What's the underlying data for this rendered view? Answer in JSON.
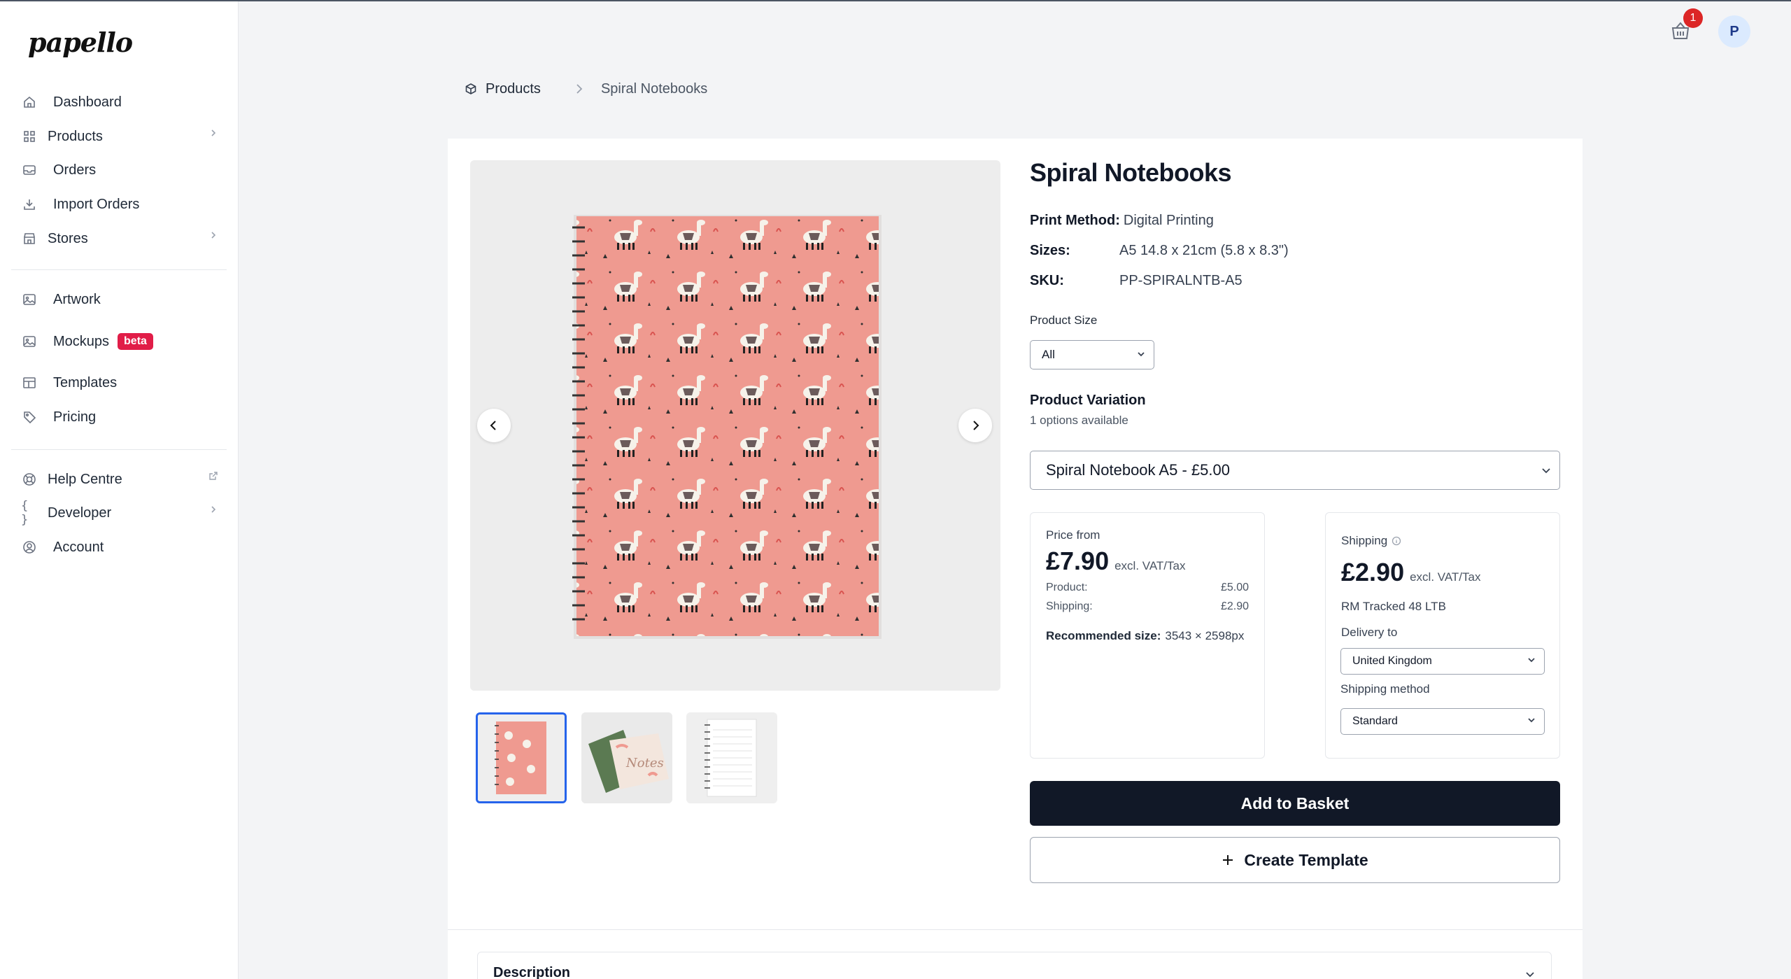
{
  "brand": {
    "logo_text": "papello"
  },
  "sidebar": {
    "items": [
      {
        "label": "Dashboard",
        "icon": "home-icon"
      },
      {
        "label": "Products",
        "icon": "grid-icon",
        "has_children": true
      },
      {
        "label": "Orders",
        "icon": "inbox-icon"
      },
      {
        "label": "Import Orders",
        "icon": "import-icon"
      },
      {
        "label": "Stores",
        "icon": "store-icon",
        "has_children": true
      },
      {
        "label": "Artwork",
        "icon": "image-icon"
      },
      {
        "label": "Mockups",
        "icon": "mockup-icon",
        "badge": "beta"
      },
      {
        "label": "Templates",
        "icon": "template-icon"
      },
      {
        "label": "Pricing",
        "icon": "tag-icon"
      },
      {
        "label": "Help Centre",
        "icon": "lifebuoy-icon",
        "external": true
      },
      {
        "label": "Developer",
        "icon": "code-icon",
        "has_children": true
      },
      {
        "label": "Account",
        "icon": "user-circle-icon"
      }
    ]
  },
  "header": {
    "cart_count": "1",
    "avatar_initial": "P"
  },
  "breadcrumb": {
    "root": "Products",
    "current": "Spiral Notebooks"
  },
  "product": {
    "title": "Spiral Notebooks",
    "print_method_label": "Print Method:",
    "print_method": "Digital Printing",
    "sizes_label": "Sizes:",
    "sizes": "A5 14.8 x 21cm (5.8 x 8.3\")",
    "sku_label": "SKU:",
    "sku": "PP-SPIRALNTB-A5",
    "size_filter_label": "Product Size",
    "size_filter_value": "All",
    "variation_title": "Product Variation",
    "variation_sub": "1 options available",
    "variation_value": "Spiral Notebook A5 - £5.00"
  },
  "price": {
    "label": "Price from",
    "amount": "£7.90",
    "excl": "excl. VAT/Tax",
    "product_label": "Product:",
    "product_value": "£5.00",
    "shipping_label": "Shipping:",
    "shipping_value": "£2.90",
    "recommended_label": "Recommended size:",
    "recommended_value": "3543 × 2598px"
  },
  "shipping": {
    "label": "Shipping",
    "amount": "£2.90",
    "excl": "excl. VAT/Tax",
    "service": "RM Tracked 48 LTB",
    "delivery_label": "Delivery to",
    "delivery_value": "United Kingdom",
    "method_label": "Shipping method",
    "method_value": "Standard"
  },
  "actions": {
    "add_to_basket": "Add to Basket",
    "create_template": "Create Template"
  },
  "description": {
    "label": "Description"
  },
  "colors": {
    "primary": "#111827",
    "accent": "#2563eb",
    "badge": "#dc2626",
    "notebook": "#ef9a90"
  }
}
